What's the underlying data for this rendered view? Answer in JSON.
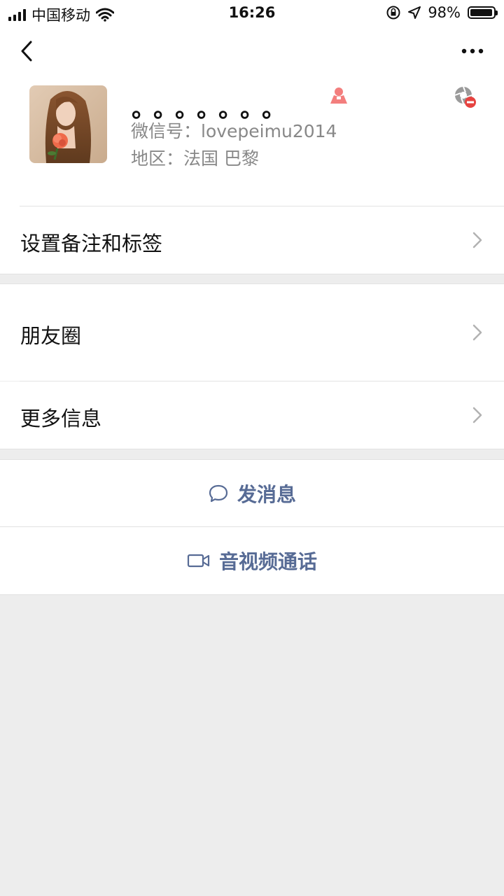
{
  "status_bar": {
    "carrier": "中国移动",
    "time": "16:26",
    "battery": "98%",
    "battery_level": 0.98,
    "icons": [
      "signal-icon",
      "wifi-icon",
      "orientation-lock-icon",
      "location-icon",
      "battery-icon"
    ]
  },
  "nav": {
    "back_icon": "chevron-left-icon",
    "more_icon": "more-dots-icon"
  },
  "profile": {
    "nickname": "。。。。。。。",
    "gender_icon": "female-icon",
    "wechat_id_label": "微信号：",
    "wechat_id": "lovepeimu2014",
    "region_label": "地区：",
    "region": "法国 巴黎",
    "status_icon": "blocked-moments-icon"
  },
  "menu": {
    "remark_tags": "设置备注和标签",
    "moments": "朋友圈",
    "more_info": "更多信息"
  },
  "actions": {
    "send_message": "发消息",
    "video_call": "音视频通话"
  },
  "colors": {
    "link_blue": "#576b95",
    "background": "#ededed",
    "female_pink": "#f37e7d"
  }
}
